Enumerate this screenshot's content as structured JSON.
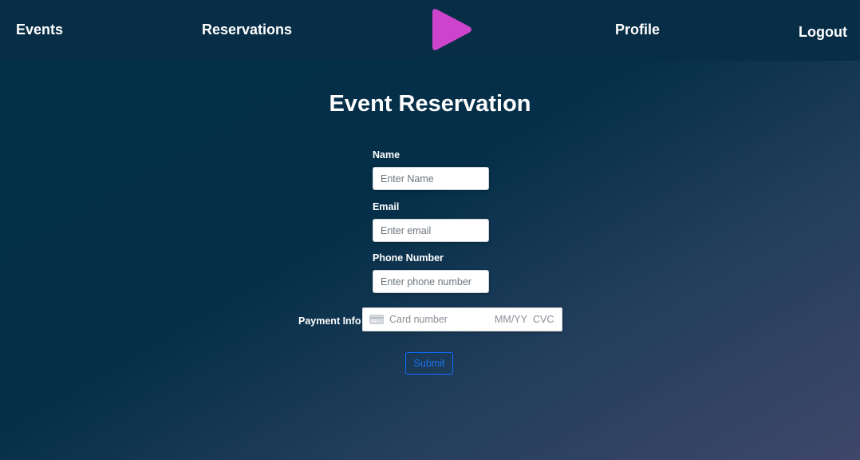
{
  "nav": {
    "events": "Events",
    "reservations": "Reservations",
    "profile": "Profile",
    "logout": "Logout",
    "logo_icon": "play-triangle-icon",
    "logo_color": "#cc44cc"
  },
  "page": {
    "title": "Event Reservation"
  },
  "form": {
    "name_label": "Name",
    "name_placeholder": "Enter Name",
    "name_value": "",
    "email_label": "Email",
    "email_placeholder": "Enter email",
    "email_value": "",
    "phone_label": "Phone Number",
    "phone_placeholder": "Enter phone number",
    "phone_value": "",
    "payment_label": "Payment Info",
    "card_icon": "credit-card-icon",
    "card_number_placeholder": "Card number",
    "card_expiry_placeholder": "MM/YY",
    "card_cvc_placeholder": "CVC",
    "submit_label": "Submit"
  },
  "colors": {
    "navbar": "#072d47",
    "background_start": "#042f48",
    "background_end": "#3f4769",
    "submit_accent": "#0d6efd"
  }
}
